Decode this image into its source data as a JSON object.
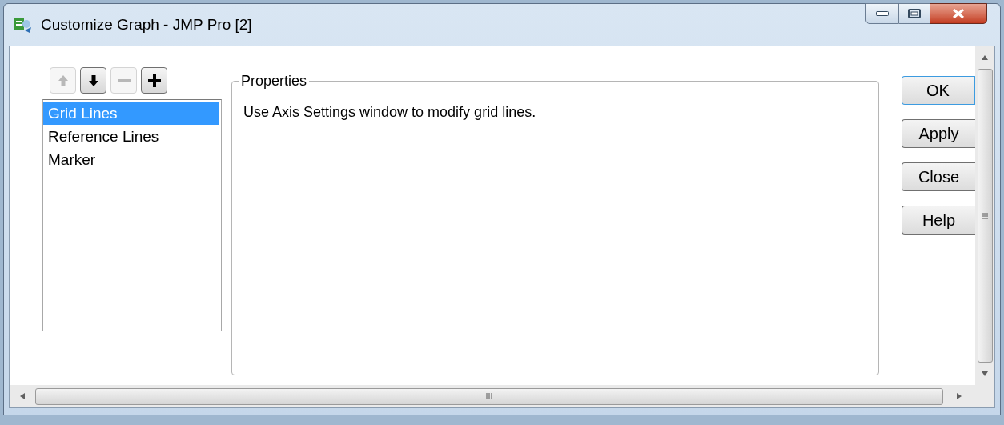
{
  "window": {
    "title": "Customize Graph - JMP Pro [2]"
  },
  "toolbar": [
    {
      "kind": "up",
      "disabled": true
    },
    {
      "kind": "down",
      "disabled": false
    },
    {
      "kind": "remove",
      "disabled": true
    },
    {
      "kind": "add",
      "disabled": false
    }
  ],
  "list": [
    {
      "label": "Grid Lines",
      "selected": true
    },
    {
      "label": "Reference Lines",
      "selected": false
    },
    {
      "label": "Marker",
      "selected": false
    }
  ],
  "properties": {
    "legend": "Properties",
    "message": "Use Axis Settings window to modify grid lines."
  },
  "buttons": [
    {
      "label": "OK",
      "focused": true
    },
    {
      "label": "Apply",
      "focused": false
    },
    {
      "label": "Close",
      "focused": false
    },
    {
      "label": "Help",
      "focused": false
    }
  ]
}
